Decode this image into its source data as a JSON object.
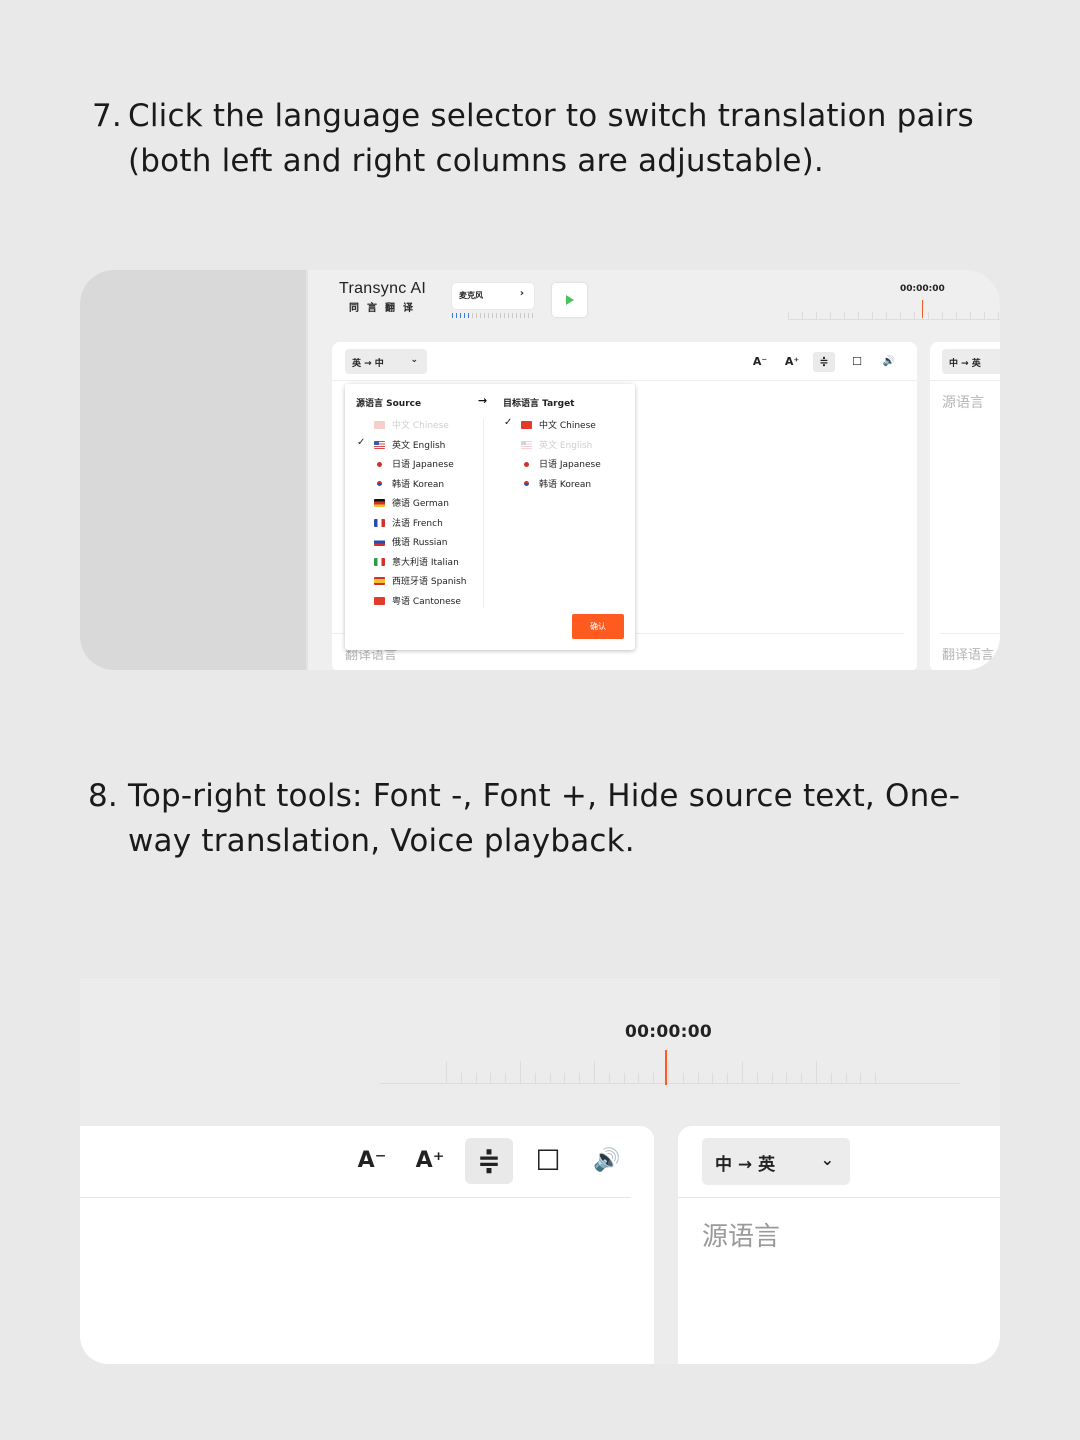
{
  "step7": {
    "num": "7.",
    "text": "Click the language selector to switch translation pairs (both left and right columns are adjustable)."
  },
  "step8": {
    "num": "8.",
    "text": "Top-right tools: Font -, Font +, Hide source text, One-way translation, Voice playback."
  },
  "shot1": {
    "brand_en": "Transync AI",
    "brand_cn": "同言翻译",
    "mic_label": "麦克风",
    "mic_chevron": "›",
    "timer": "00:00:00",
    "left_pair": "英 → 中",
    "right_pair": "中 → 英",
    "dropdown_caret": "⌄",
    "source_placeholder": "源语言",
    "target_placeholder_left": "翻译语言",
    "target_placeholder_right": "翻译语言",
    "tools": [
      "A⁻",
      "A⁺",
      "≑",
      "☐",
      "🔊"
    ],
    "dropdown": {
      "source_header": "源语言 Source",
      "target_header": "目标语言 Target",
      "arrow": "→",
      "check": "✓",
      "source_langs": [
        {
          "label": "中文 Chinese",
          "flag": "cn",
          "disabled": true,
          "checked": false
        },
        {
          "label": "英文 English",
          "flag": "us",
          "disabled": false,
          "checked": true
        },
        {
          "label": "日语 Japanese",
          "flag": "jp",
          "disabled": false,
          "checked": false
        },
        {
          "label": "韩语 Korean",
          "flag": "kr",
          "disabled": false,
          "checked": false
        },
        {
          "label": "德语 German",
          "flag": "de",
          "disabled": false,
          "checked": false
        },
        {
          "label": "法语 French",
          "flag": "fr",
          "disabled": false,
          "checked": false
        },
        {
          "label": "俄语 Russian",
          "flag": "ru",
          "disabled": false,
          "checked": false
        },
        {
          "label": "意大利语 Italian",
          "flag": "it",
          "disabled": false,
          "checked": false
        },
        {
          "label": "西班牙语 Spanish",
          "flag": "es",
          "disabled": false,
          "checked": false
        },
        {
          "label": "粤语 Cantonese",
          "flag": "hk",
          "disabled": false,
          "checked": false
        }
      ],
      "target_langs": [
        {
          "label": "中文 Chinese",
          "flag": "cn",
          "disabled": false,
          "checked": true
        },
        {
          "label": "英文 English",
          "flag": "us",
          "disabled": true,
          "checked": false
        },
        {
          "label": "日语 Japanese",
          "flag": "jp",
          "disabled": false,
          "checked": false
        },
        {
          "label": "韩语 Korean",
          "flag": "kr",
          "disabled": false,
          "checked": false
        }
      ],
      "confirm_label": "确认"
    }
  },
  "shot2": {
    "timer": "00:00:00",
    "font_minus": "A⁻",
    "font_plus": "A⁺",
    "hide_source": "≑",
    "one_way": "☐",
    "voice": "🔊",
    "right_pair": "中 → 英",
    "dropdown_caret": "⌄",
    "source_placeholder": "源语言"
  },
  "colors": {
    "accent": "#ff5a1f",
    "play": "#4cc35a",
    "meter": "#3a7bd5",
    "background": "#e9e9e9"
  }
}
